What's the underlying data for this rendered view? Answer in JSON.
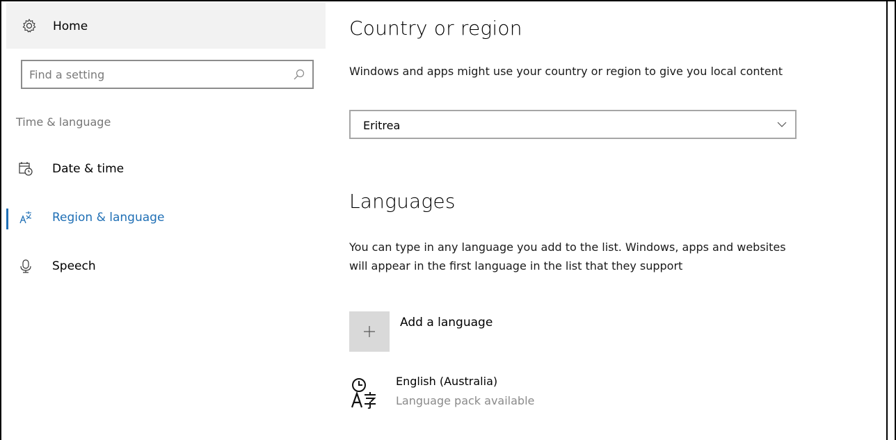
{
  "sidebar": {
    "home_label": "Home",
    "search_placeholder": "Find a setting",
    "section_label": "Time & language",
    "items": [
      {
        "label": "Date & time",
        "icon": "calendar-clock-icon"
      },
      {
        "label": "Region & language",
        "icon": "region-language-icon",
        "active": true
      },
      {
        "label": "Speech",
        "icon": "microphone-icon"
      }
    ]
  },
  "main": {
    "country": {
      "title": "Country or region",
      "description": "Windows and apps might use your country or region to give you local content",
      "selected": "Eritrea"
    },
    "languages": {
      "title": "Languages",
      "description": "You can type in any language you add to the list. Windows, apps and websites will appear in the first language in the list that they support",
      "add_label": "Add a language",
      "list": [
        {
          "name": "English (Australia)",
          "status": "Language pack available"
        }
      ]
    }
  },
  "colors": {
    "accent": "#1f6fb5",
    "home_bg": "#f2f2f2",
    "tile_bg": "#d9d9d9"
  }
}
